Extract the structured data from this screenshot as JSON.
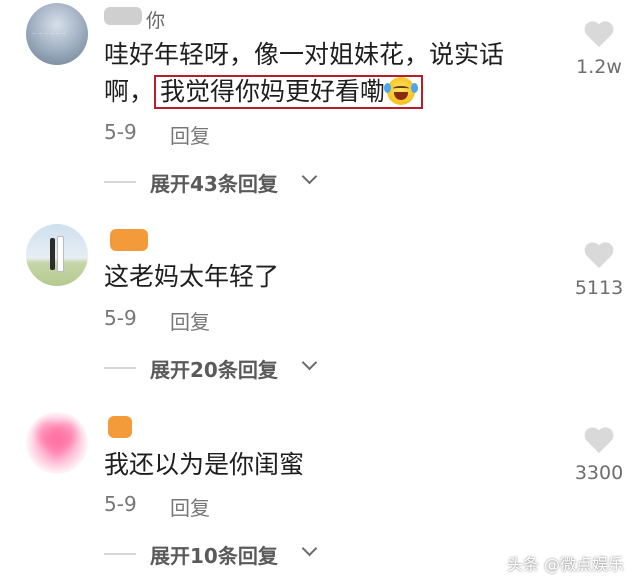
{
  "comments": [
    {
      "username_visible": "你",
      "text_line1": "哇好年轻呀，像一对姐妹花，说实话",
      "text_line2_prefix": "啊，",
      "text_highlight": "我觉得你妈更好看嘞",
      "emoji": "rolling-on-floor-laughing-emoji",
      "date": "5-9",
      "reply_label": "回复",
      "expand_label": "展开43条回复",
      "likes": "1.2w"
    },
    {
      "username_visible": "",
      "text_line1": "这老妈太年轻了",
      "date": "5-9",
      "reply_label": "回复",
      "expand_label": "展开20条回复",
      "likes": "5113"
    },
    {
      "username_visible": "",
      "text_line1": "我还以为是你闺蜜",
      "date": "5-9",
      "reply_label": "回复",
      "expand_label": "展开10条回复",
      "likes": "3300"
    }
  ],
  "watermark": "头条 @微点娱乐",
  "colors": {
    "highlight_border": "#b91c2a",
    "name_redaction": "#f39a3a",
    "like_icon": "#d9d9d9"
  }
}
